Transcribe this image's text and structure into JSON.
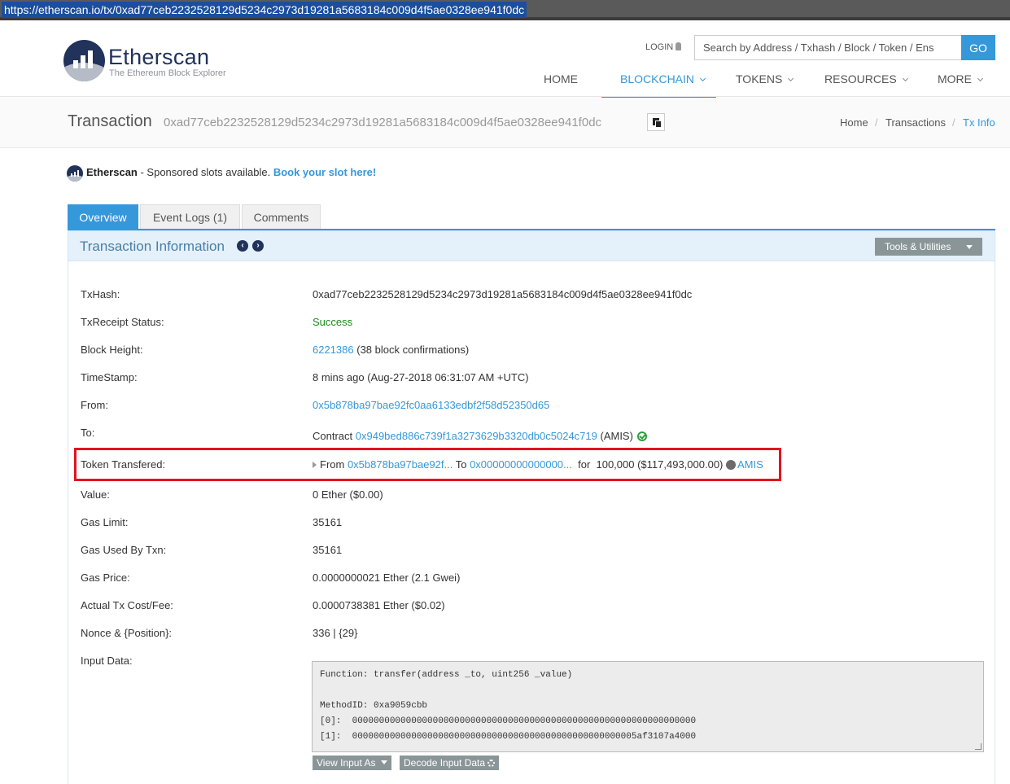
{
  "browser": {
    "url": "https://etherscan.io/tx/0xad77ceb2232528129d5234c2973d19281a5683184c009d4f5ae0328ee941f0dc"
  },
  "header": {
    "logo_name": "Etherscan",
    "logo_tagline": "The Ethereum Block Explorer",
    "login_label": "LOGIN",
    "search_placeholder": "Search by Address / Txhash / Block / Token / Ens",
    "go_label": "GO",
    "nav": [
      "HOME",
      "BLOCKCHAIN",
      "TOKENS",
      "RESOURCES",
      "MORE"
    ],
    "active_nav": "BLOCKCHAIN"
  },
  "title": {
    "label": "Transaction",
    "txid": "0xad77ceb2232528129d5234c2973d19281a5683184c009d4f5ae0328ee941f0dc",
    "breadcrumbs": [
      "Home",
      "Transactions",
      "Tx Info"
    ]
  },
  "sponsor": {
    "brand": "Etherscan",
    "text": " - Sponsored slots available. ",
    "link": "Book your slot here!"
  },
  "tabs": [
    "Overview",
    "Event Logs (1)",
    "Comments"
  ],
  "panel": {
    "title": "Transaction Information",
    "prev_icon": "chevron-left-icon",
    "next_icon": "chevron-right-icon",
    "tools_label": "Tools & Utilities"
  },
  "details": {
    "txhash": {
      "label": "TxHash:",
      "value": "0xad77ceb2232528129d5234c2973d19281a5683184c009d4f5ae0328ee941f0dc"
    },
    "status": {
      "label": "TxReceipt Status:",
      "value": "Success"
    },
    "block": {
      "label": "Block Height:",
      "link": "6221386",
      "suffix": " (38 block confirmations)"
    },
    "timestamp": {
      "label": "TimeStamp:",
      "value": "8 mins ago (Aug-27-2018 06:31:07 AM +UTC)"
    },
    "from": {
      "label": "From:",
      "link": "0x5b878ba97bae92fc0aa6133edbf2f58d52350d65"
    },
    "to": {
      "label": "To:",
      "prefix": "Contract ",
      "link": "0x949bed886c739f1a3273629b3320db0c5024c719",
      "suffix": " (AMIS)"
    },
    "token": {
      "label": "Token Transfered:",
      "from_prefix": "From ",
      "from_link": "0x5b878ba97bae92f...",
      "to_prefix": " To ",
      "to_link": "0x00000000000000...",
      "amount": "  for  100,000 ($117,493,000.00) ",
      "token_link": "AMIS"
    },
    "value": {
      "label": "Value:",
      "value": "0 Ether ($0.00)"
    },
    "gas_limit": {
      "label": "Gas Limit:",
      "value": "35161"
    },
    "gas_used": {
      "label": "Gas Used By Txn:",
      "value": "35161"
    },
    "gas_price": {
      "label": "Gas Price:",
      "value": "0.0000000021 Ether (2.1 Gwei)"
    },
    "fee": {
      "label": "Actual Tx Cost/Fee:",
      "value": "0.0000738381 Ether ($0.02)"
    },
    "nonce": {
      "label": "Nonce & {Position}:",
      "value": "336 | {29}"
    },
    "input": {
      "label": "Input Data:",
      "lines": [
        "Function: transfer(address _to, uint256 _value)",
        "",
        "MethodID: 0xa9059cbb",
        "[0]:  0000000000000000000000000000000000000000000000000000000000000000",
        "[1]:  00000000000000000000000000000000000000000000000000005af3107a4000"
      ],
      "view_as_label": "View Input As",
      "decode_label": "Decode Input Data"
    }
  },
  "colors": {
    "accent": "#3498db",
    "highlight_box": "#e0151f",
    "success": "#1a8c1a",
    "brand_dark": "#21325b"
  }
}
